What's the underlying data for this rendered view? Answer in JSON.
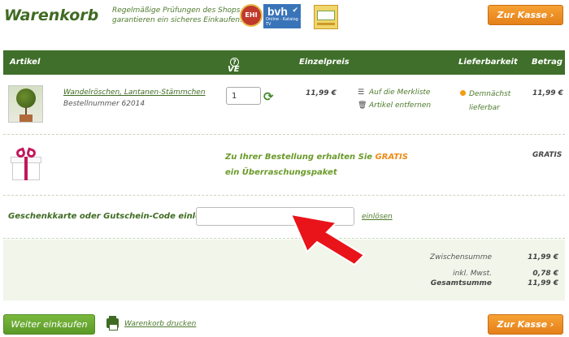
{
  "header": {
    "title": "Warenkorb",
    "trust_text": "Regelmäßige Prüfungen des Shops garantieren ein sicheres Einkaufen.",
    "badges": {
      "ehi": "EHI",
      "bvh": "bvh",
      "bvh_sub": "Online · Katalog · TV"
    },
    "checkout_label": "Zur Kasse ›"
  },
  "table": {
    "columns": {
      "article": "Artikel",
      "ve": "VE",
      "unit_price": "Einzelpreis",
      "availability": "Lieferbarkeit",
      "amount": "Betrag"
    }
  },
  "item": {
    "name": "Wandelröschen, Lantanen-Stämmchen",
    "sku": "Bestellnummer 62014",
    "quantity": "1",
    "unit_price": "11,99 €",
    "wishlist_label": "Auf die Merkliste",
    "remove_label": "Artikel entfernen",
    "availability": "Demnächst lieferbar",
    "amount": "11,99 €"
  },
  "gift": {
    "text_pre": "Zu Ihrer Bestellung erhalten Sie ",
    "text_highlight": "GRATIS",
    "text_post": " ein Überraschungspaket",
    "amount": "GRATIS"
  },
  "voucher": {
    "label": "Geschenkkarte oder Gutschein-Code einlösen:",
    "value": "",
    "redeem_label": "einlösen"
  },
  "summary": {
    "subtotal_label": "Zwischensumme",
    "subtotal": "11,99 €",
    "vat_label": "inkl. Mwst.",
    "vat": "0,78 €",
    "total_label": "Gesamtsumme",
    "total": "11,99 €"
  },
  "footer": {
    "continue_label": "Weiter einkaufen",
    "print_label": "Warenkorb drucken",
    "checkout_label": "Zur Kasse ›"
  },
  "colors": {
    "brand_green": "#3f6f2a",
    "accent_orange": "#f08a16",
    "annotation_red": "#e8141a"
  }
}
